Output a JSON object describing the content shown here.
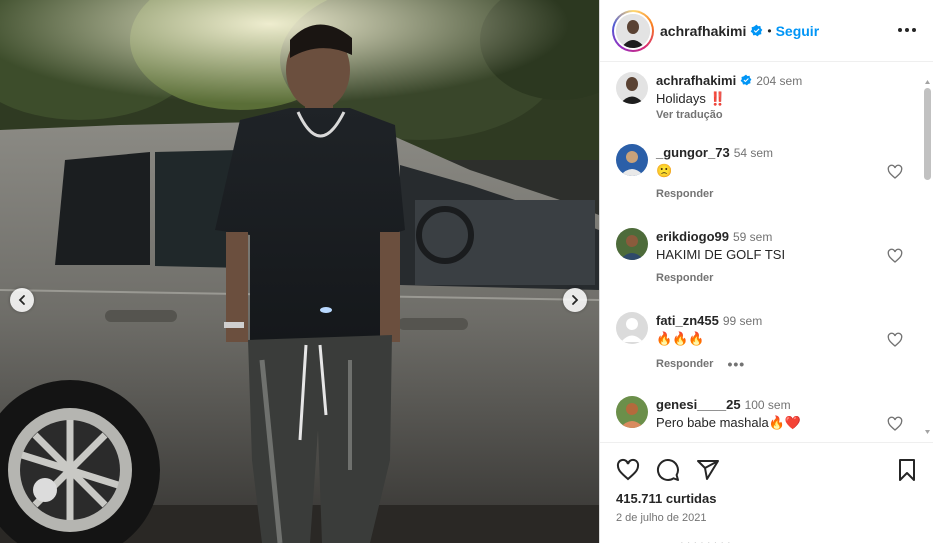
{
  "post": {
    "author": "achrafhakimi",
    "follow_label": "Seguir",
    "dot": "•",
    "caption": {
      "author": "achrafhakimi",
      "time": "204 sem",
      "text": "Holidays ‼️",
      "translate_label": "Ver tradução"
    },
    "likes_text": "415.711 curtidas",
    "date_text": "2 de julho de 2021",
    "add_comment_partial": "· · · · · · · ·"
  },
  "comments": [
    {
      "user": "_gungor_73",
      "time": "54 sem",
      "text": "🙁",
      "reply_label": "Responder",
      "more": "",
      "avatar_color": "#2b5fa8"
    },
    {
      "user": "erikdiogo99",
      "time": "59 sem",
      "text": "HAKIMI DE GOLF TSI",
      "reply_label": "Responder",
      "more": "",
      "avatar_color": "#4d6b3a"
    },
    {
      "user": "fati_zn455",
      "time": "99 sem",
      "text": "🔥🔥🔥",
      "reply_label": "Responder",
      "more": "•••",
      "avatar_color": "#dbdbdb"
    },
    {
      "user": "genesi____25",
      "time": "100 sem",
      "text": "Pero babe mashala🔥❤️",
      "reply_label": "",
      "more": "",
      "avatar_color": "#b46a3c"
    }
  ],
  "icons": {
    "verified": "verified-badge-icon",
    "more": "more-options-icon",
    "like": "heart-icon",
    "comment": "comment-icon",
    "share": "share-icon",
    "save": "bookmark-icon",
    "prev": "chevron-left-icon",
    "next": "chevron-right-icon"
  },
  "colors": {
    "accent": "#0095f6",
    "text": "#262626",
    "muted": "#737373",
    "verified": "#0095f6"
  }
}
